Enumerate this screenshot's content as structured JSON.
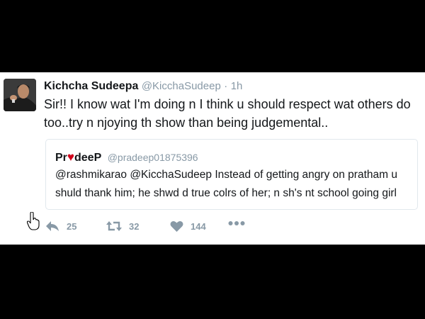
{
  "tweet": {
    "display_name": "Kichcha Sudeepa",
    "handle": "@KicchaSudeep",
    "separator": "·",
    "time": "1h",
    "text": "Sir!! I know wat I'm doing n I think u should respect wat others do too..try n njoying th show than being judgemental..",
    "avatar": "avatar-photo"
  },
  "quoted_tweet": {
    "name_start": "Pr",
    "name_icon": "heart-icon",
    "name_end": "deeP",
    "handle": "@pradeep01875396",
    "text": "@rashmikarao @KicchaSudeep Instead of getting angry on pratham u shuld thank him; he shwd d true colrs of her; n sh's nt school going girl"
  },
  "actions": {
    "reply": {
      "icon": "reply-icon",
      "count": "25"
    },
    "retweet": {
      "icon": "retweet-icon",
      "count": "32"
    },
    "like": {
      "icon": "heart-outline-icon",
      "count": "144"
    },
    "more": {
      "icon": "more-dots-icon"
    }
  },
  "colors": {
    "background": "#000000",
    "card": "#ffffff",
    "text": "#14171a",
    "muted": "#8899a6",
    "heart": "#d0021b",
    "border": "#e1e8ed"
  }
}
